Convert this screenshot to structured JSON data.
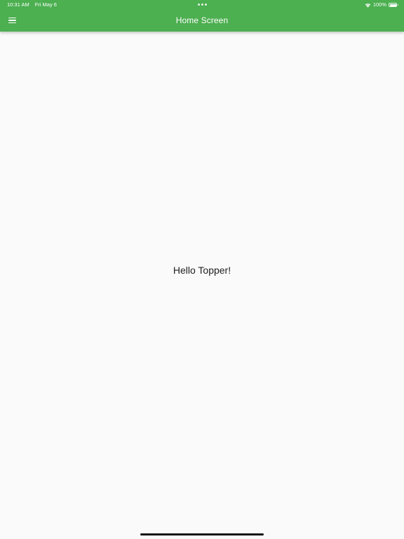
{
  "status_bar": {
    "time": "10:31 AM",
    "date": "Fri May 6",
    "battery_text": "100%",
    "battery_level": 1.0,
    "wifi_icon": "wifi-icon",
    "battery_icon": "battery-icon"
  },
  "app_bar": {
    "title": "Home Screen",
    "menu_icon": "hamburger-menu-icon"
  },
  "main": {
    "greeting": "Hello Topper!"
  },
  "colors": {
    "app_bar": "#4caf50",
    "background": "#fafafa",
    "text": "#212121"
  }
}
